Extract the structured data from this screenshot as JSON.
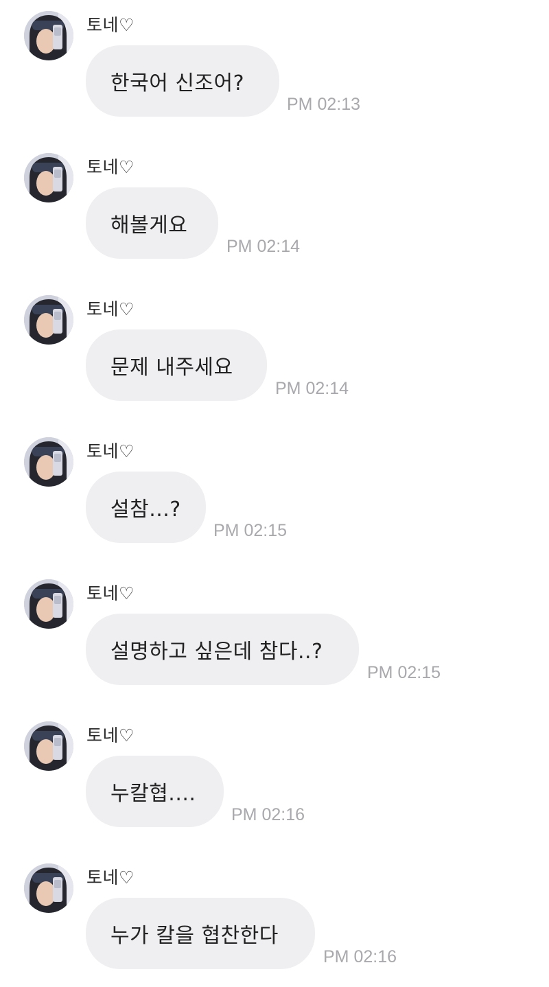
{
  "chat": {
    "messages": [
      {
        "sender": "토네♡",
        "text": "한국어 신조어?",
        "time": "PM 02:13"
      },
      {
        "sender": "토네♡",
        "text": "해볼게요",
        "time": "PM 02:14"
      },
      {
        "sender": "토네♡",
        "text": "문제 내주세요",
        "time": "PM 02:14"
      },
      {
        "sender": "토네♡",
        "text": "설참...?",
        "time": "PM 02:15"
      },
      {
        "sender": "토네♡",
        "text": "설명하고 싶은데 참다..?",
        "time": "PM 02:15"
      },
      {
        "sender": "토네♡",
        "text": "누칼협....",
        "time": "PM 02:16"
      },
      {
        "sender": "토네♡",
        "text": "누가 칼을 협찬한다",
        "time": "PM 02:16"
      }
    ]
  },
  "colors": {
    "bubble": "#efeff2",
    "timestamp": "#a9a9ad",
    "text": "#222222"
  },
  "icons": {
    "avatar": "profile-photo-avatar"
  }
}
